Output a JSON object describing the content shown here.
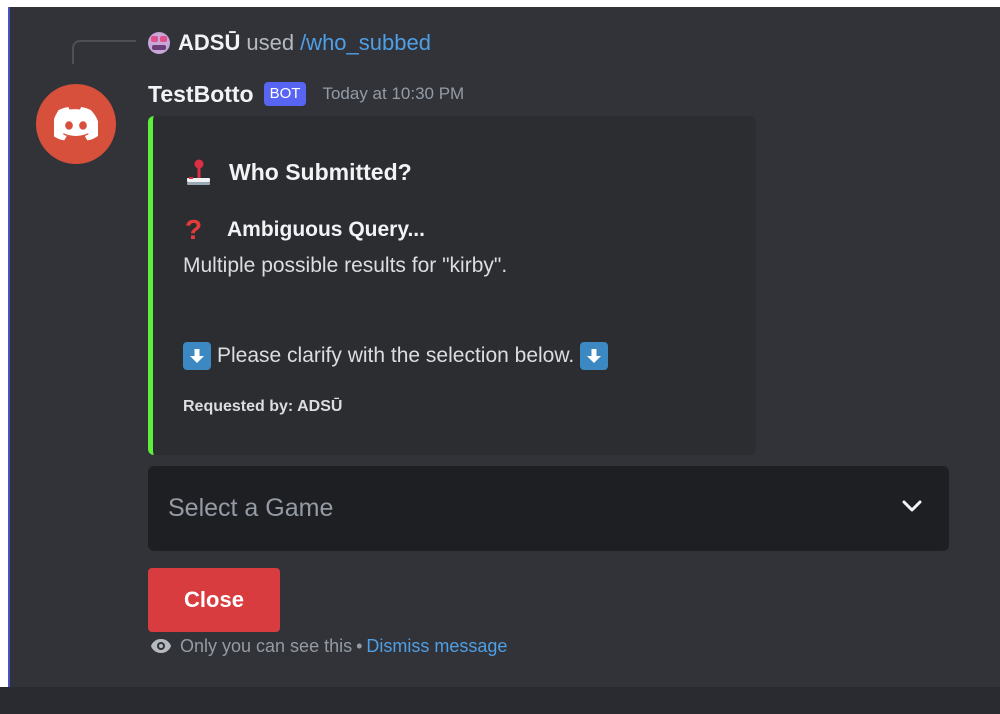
{
  "reply": {
    "username": "ADSŪ",
    "used_text": "used",
    "command": "/who_subbed"
  },
  "message": {
    "bot_name": "TestBotto",
    "bot_tag": "BOT",
    "timestamp": "Today at 10:30 PM"
  },
  "embed": {
    "accent_color": "#5cf03c",
    "title": "Who Submitted?",
    "title_icon": "joystick-icon",
    "field_icon": "question-icon",
    "field_name": "Ambiguous Query...",
    "field_value": "Multiple possible results for \"kirby\".",
    "clarify_text": "Please clarify with the selection below.",
    "clarify_icon": "arrow-down-icon",
    "footer": "Requested by: ADSŪ"
  },
  "select": {
    "placeholder": "Select a Game"
  },
  "buttons": {
    "close_label": "Close",
    "close_color": "#d83c3e"
  },
  "ephemeral": {
    "notice": "Only you can see this",
    "separator": "•",
    "dismiss_label": "Dismiss message"
  }
}
